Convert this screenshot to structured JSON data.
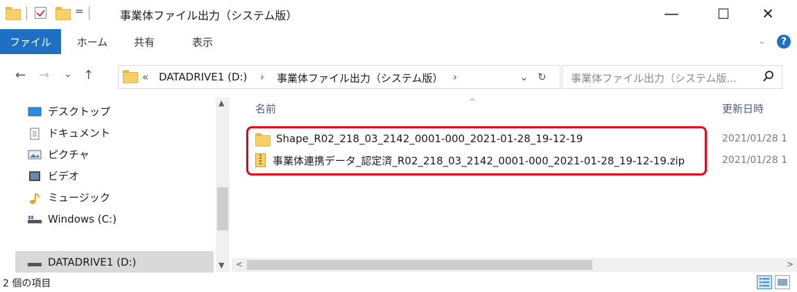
{
  "window": {
    "title": "事業体ファイル出力（システム版）",
    "minimize": "—",
    "maximize": "☐",
    "close": "✕"
  },
  "quick_access": {
    "dropdown": "="
  },
  "ribbon": {
    "tabs": [
      "ファイル",
      "ホーム",
      "共有",
      "表示"
    ],
    "help": "?"
  },
  "nav": {
    "back": "←",
    "forward": "→",
    "recent": "⌄",
    "up": "↑"
  },
  "address": {
    "overflow": "«",
    "segments": [
      "DATADRIVE1 (D:)",
      "事業体ファイル出力（システム版）"
    ],
    "separator": "›",
    "dropdown": "⌄",
    "refresh": "↻"
  },
  "search": {
    "placeholder": "事業体ファイル出力（システム版..."
  },
  "navpane": {
    "items": [
      {
        "label": "デスクトップ",
        "icon": "desktop-icon"
      },
      {
        "label": "ドキュメント",
        "icon": "document-icon"
      },
      {
        "label": "ピクチャ",
        "icon": "pictures-icon"
      },
      {
        "label": "ビデオ",
        "icon": "video-icon"
      },
      {
        "label": "ミュージック",
        "icon": "music-icon"
      },
      {
        "label": "Windows (C:)",
        "icon": "drive-icon"
      },
      {
        "label": "DATADRIVE1 (D:)",
        "icon": "drive-icon"
      }
    ]
  },
  "filelist": {
    "columns": {
      "name": "名前",
      "modified": "更新日時"
    },
    "rows": [
      {
        "name": "Shape_R02_218_03_2142_0001-000_2021-01-28_19-12-19",
        "modified": "2021/01/28 1",
        "type": "folder"
      },
      {
        "name": "事業体連携データ_認定済_R02_218_03_2142_0001-000_2021-01-28_19-12-19.zip",
        "modified": "2021/01/28 1",
        "type": "zip"
      }
    ]
  },
  "status": {
    "count": "2 個の項目"
  },
  "colors": {
    "accent": "#1f6fc3",
    "highlight": "#e4001b",
    "selected": "#d9d9d9"
  }
}
